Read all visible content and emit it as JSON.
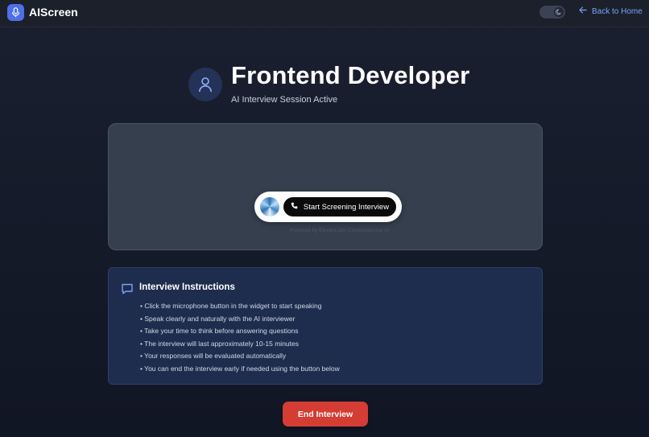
{
  "app": {
    "name": "AIScreen",
    "back_label": "Back to Home"
  },
  "header": {
    "title": "Frontend Developer",
    "subtitle": "AI Interview Session Active"
  },
  "widget": {
    "start_label": "Start Screening Interview",
    "powered_by": "Powered by ElevenLabs Conversational AI"
  },
  "instructions": {
    "title": "Interview Instructions",
    "items": [
      "• Click the microphone button in the widget to start speaking",
      "• Speak clearly and naturally with the AI interviewer",
      "• Take your time to think before answering questions",
      "• The interview will last approximately 10-15 minutes",
      "• Your responses will be evaluated automatically",
      "• You can end the interview early if needed using the button below"
    ]
  },
  "actions": {
    "end_label": "End Interview"
  },
  "colors": {
    "accent": "#4f6fe8",
    "link": "#7aa2f7",
    "danger": "#d43c34"
  },
  "icons": {
    "logo": "microphone-icon",
    "theme": "moon-icon",
    "back": "arrow-left-icon",
    "avatar": "user-icon",
    "start": "phone-icon",
    "instructions": "chat-bubble-icon"
  }
}
